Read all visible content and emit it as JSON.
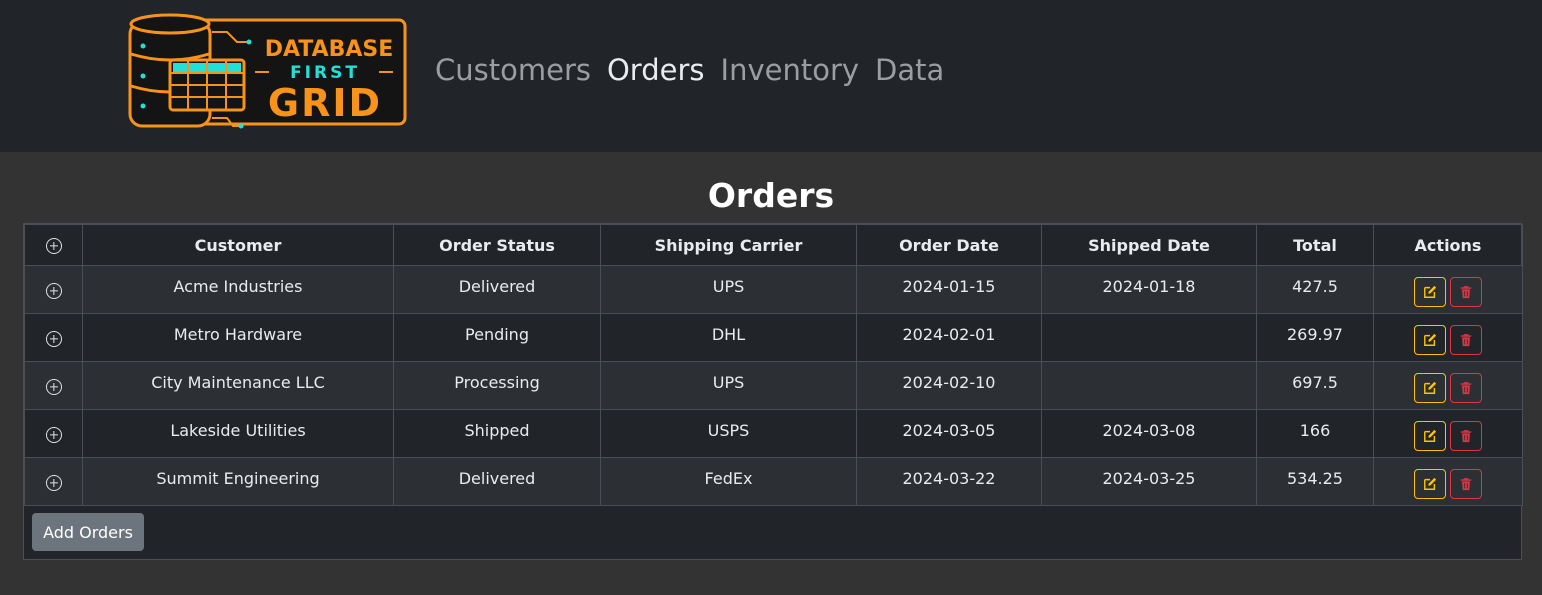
{
  "brand": {
    "logo_line1": "DATABASE",
    "logo_line2": "FIRST",
    "logo_line3": "GRID",
    "colors": {
      "orange": "#f7931a",
      "cyan": "#22e0d8"
    }
  },
  "nav": {
    "items": [
      {
        "label": "Customers",
        "active": false
      },
      {
        "label": "Orders",
        "active": true
      },
      {
        "label": "Inventory",
        "active": false
      },
      {
        "label": "Data",
        "active": false
      }
    ]
  },
  "page": {
    "title": "Orders"
  },
  "grid": {
    "columns": [
      "Customer",
      "Order Status",
      "Shipping Carrier",
      "Order Date",
      "Shipped Date",
      "Total",
      "Actions"
    ],
    "rows": [
      {
        "customer": "Acme Industries",
        "status": "Delivered",
        "carrier": "UPS",
        "order_date": "2024-01-15",
        "shipped_date": "2024-01-18",
        "total": "427.5"
      },
      {
        "customer": "Metro Hardware",
        "status": "Pending",
        "carrier": "DHL",
        "order_date": "2024-02-01",
        "shipped_date": "",
        "total": "269.97"
      },
      {
        "customer": "City Maintenance LLC",
        "status": "Processing",
        "carrier": "UPS",
        "order_date": "2024-02-10",
        "shipped_date": "",
        "total": "697.5"
      },
      {
        "customer": "Lakeside Utilities",
        "status": "Shipped",
        "carrier": "USPS",
        "order_date": "2024-03-05",
        "shipped_date": "2024-03-08",
        "total": "166"
      },
      {
        "customer": "Summit Engineering",
        "status": "Delivered",
        "carrier": "FedEx",
        "order_date": "2024-03-22",
        "shipped_date": "2024-03-25",
        "total": "534.25"
      }
    ],
    "add_label": "Add Orders",
    "icons": {
      "expand": "plus-circle-icon",
      "edit": "pencil-square-icon",
      "delete": "trash-icon"
    },
    "colors": {
      "edit": "#ffc107",
      "delete": "#dc3545"
    }
  }
}
